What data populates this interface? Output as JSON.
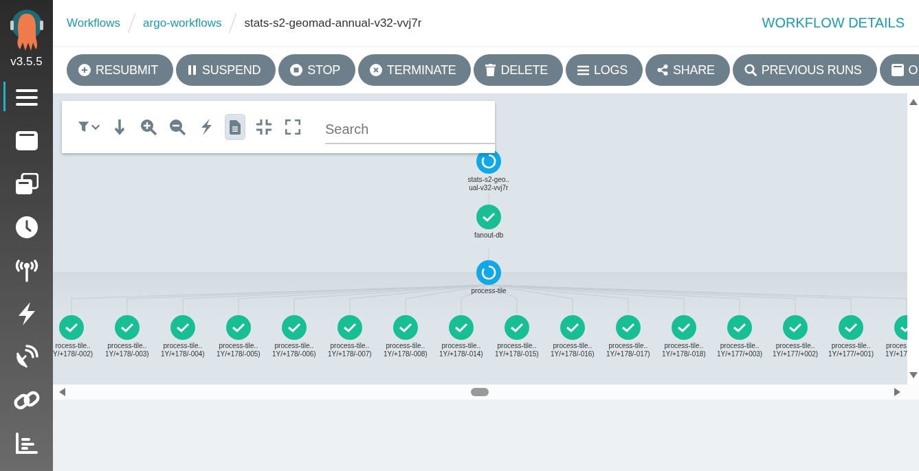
{
  "sidebar": {
    "version": "v3.5.5",
    "nav_items": [
      {
        "selected": true
      },
      {
        "selected": false
      },
      {
        "selected": false
      },
      {
        "selected": false
      },
      {
        "selected": false
      },
      {
        "selected": false
      },
      {
        "selected": false
      },
      {
        "selected": false
      },
      {
        "selected": false
      }
    ]
  },
  "breadcrumbs": [
    {
      "label": "Workflows",
      "kind": "link"
    },
    {
      "label": "argo-workflows",
      "kind": "link"
    },
    {
      "label": "stats-s2-geomad-annual-v32-vvj7r",
      "kind": "current"
    }
  ],
  "page_title": "WORKFLOW DETAILS",
  "actions": [
    {
      "label": "RESUBMIT"
    },
    {
      "label": "SUSPEND"
    },
    {
      "label": "STOP"
    },
    {
      "label": "TERMINATE"
    },
    {
      "label": "DELETE"
    },
    {
      "label": "LOGS"
    },
    {
      "label": "SHARE"
    },
    {
      "label": "PREVIOUS RUNS"
    },
    {
      "label": "O"
    }
  ],
  "graph_toolbar": {
    "tools": [
      {
        "selected": false
      },
      {
        "selected": false
      },
      {
        "selected": false
      },
      {
        "selected": false
      },
      {
        "selected": false
      },
      {
        "selected": true
      },
      {
        "selected": false
      },
      {
        "selected": false
      }
    ],
    "search": {
      "placeholder": "Search"
    }
  },
  "graph": {
    "nodes": [
      {
        "lines": [
          "stats-s2-geo..",
          "ual-v32-vvj7r"
        ],
        "kind": "running",
        "children": [
          {
            "lines": [
              "fanout-db"
            ],
            "kind": "succeeded",
            "children": [
              {
                "lines": [
                  "process-tile"
                ],
                "kind": "running",
                "children": [
                  {
                    "lines": [
                      "rocess-tile..",
                      "Y/+178/-002)"
                    ],
                    "kind": "succeeded"
                  },
                  {
                    "lines": [
                      "process-tile..",
                      "1Y/+178/-003)"
                    ],
                    "kind": "succeeded"
                  },
                  {
                    "lines": [
                      "process-tile..",
                      "1Y/+178/-004)"
                    ],
                    "kind": "succeeded"
                  },
                  {
                    "lines": [
                      "process-tile..",
                      "1Y/+178/-005)"
                    ],
                    "kind": "succeeded"
                  },
                  {
                    "lines": [
                      "process-tile..",
                      "1Y/+178/-006)"
                    ],
                    "kind": "succeeded"
                  },
                  {
                    "lines": [
                      "process-tile..",
                      "1Y/+178/-007)"
                    ],
                    "kind": "succeeded"
                  },
                  {
                    "lines": [
                      "process-tile..",
                      "1Y/+178/-008)"
                    ],
                    "kind": "succeeded"
                  },
                  {
                    "lines": [
                      "process-tile..",
                      "1Y/+178/-014)"
                    ],
                    "kind": "succeeded"
                  },
                  {
                    "lines": [
                      "process-tile..",
                      "1Y/+178/-015)"
                    ],
                    "kind": "succeeded"
                  },
                  {
                    "lines": [
                      "process-tile..",
                      "1Y/+178/-016)"
                    ],
                    "kind": "succeeded"
                  },
                  {
                    "lines": [
                      "process-tile..",
                      "1Y/+178/-017)"
                    ],
                    "kind": "succeeded"
                  },
                  {
                    "lines": [
                      "process-tile..",
                      "1Y/+178/-018)"
                    ],
                    "kind": "succeeded"
                  },
                  {
                    "lines": [
                      "process-tile..",
                      "1Y/+177/+003)"
                    ],
                    "kind": "succeeded"
                  },
                  {
                    "lines": [
                      "process-tile..",
                      "1Y/+177/+002)"
                    ],
                    "kind": "succeeded"
                  },
                  {
                    "lines": [
                      "process-tile..",
                      "1Y/+177/+001)"
                    ],
                    "kind": "succeeded"
                  },
                  {
                    "lines": [
                      "proces",
                      "1Y/+17"
                    ],
                    "kind": "succeeded"
                  }
                ]
              }
            ]
          }
        ]
      }
    ]
  }
}
